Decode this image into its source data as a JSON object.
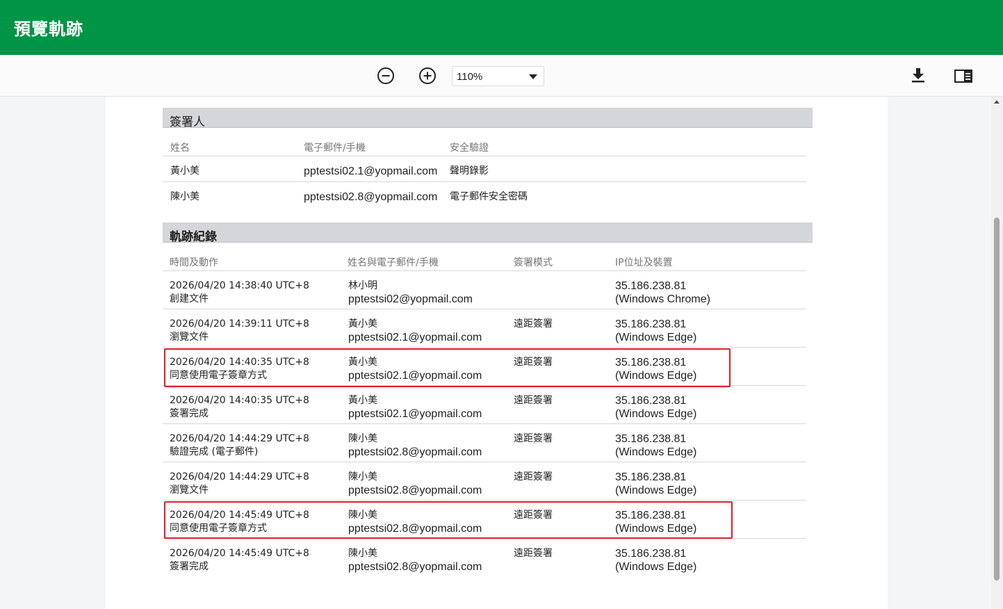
{
  "header": {
    "title": "預覽軌跡"
  },
  "toolbar": {
    "zoom_value": "110%",
    "icons": [
      "zoom-out-icon",
      "zoom-in-icon",
      "download-icon",
      "sidebar-toggle-icon"
    ]
  },
  "signers": {
    "title": "簽署人",
    "columns": [
      "姓名",
      "電子郵件/手機",
      "安全驗證"
    ],
    "rows": [
      {
        "name": "黃小美",
        "email": "pptestsi02.1@yopmail.com",
        "verify": "聲明錄影"
      },
      {
        "name": "陳小美",
        "email": "pptestsi02.8@yopmail.com",
        "verify": "電子郵件安全密碼"
      }
    ]
  },
  "log": {
    "title": "軌跡紀錄",
    "columns": [
      "時間及動作",
      "姓名與電子郵件/手機",
      "簽署模式",
      "IP位址及裝置"
    ],
    "rows": [
      {
        "time": "2026/04/20 14:38:40 UTC+8",
        "action": "創建文件",
        "name": "林小明",
        "email": "pptestsi02@yopmail.com",
        "mode": "",
        "ip": "35.186.238.81",
        "device": "(Windows Chrome)"
      },
      {
        "time": "2026/04/20 14:39:11 UTC+8",
        "action": "瀏覽文件",
        "name": "黃小美",
        "email": "pptestsi02.1@yopmail.com",
        "mode": "遠距簽署",
        "ip": "35.186.238.81",
        "device": "(Windows Edge)"
      },
      {
        "time": "2026/04/20 14:40:35 UTC+8",
        "action": "同意使用電子簽章方式",
        "name": "黃小美",
        "email": "pptestsi02.1@yopmail.com",
        "mode": "遠距簽署",
        "ip": "35.186.238.81",
        "device": "(Windows Edge)"
      },
      {
        "time": "2026/04/20 14:40:35 UTC+8",
        "action": "簽署完成",
        "name": "黃小美",
        "email": "pptestsi02.1@yopmail.com",
        "mode": "遠距簽署",
        "ip": "35.186.238.81",
        "device": "(Windows Edge)"
      },
      {
        "time": "2026/04/20 14:44:29 UTC+8",
        "action": "驗證完成 (電子郵件)",
        "name": "陳小美",
        "email": "pptestsi02.8@yopmail.com",
        "mode": "遠距簽署",
        "ip": "35.186.238.81",
        "device": "(Windows Edge)"
      },
      {
        "time": "2026/04/20 14:44:29 UTC+8",
        "action": "瀏覽文件",
        "name": "陳小美",
        "email": "pptestsi02.8@yopmail.com",
        "mode": "遠距簽署",
        "ip": "35.186.238.81",
        "device": "(Windows Edge)"
      },
      {
        "time": "2026/04/20 14:45:49 UTC+8",
        "action": "同意使用電子簽章方式",
        "name": "陳小美",
        "email": "pptestsi02.8@yopmail.com",
        "mode": "遠距簽署",
        "ip": "35.186.238.81",
        "device": "(Windows Edge)"
      },
      {
        "time": "2026/04/20 14:45:49 UTC+8",
        "action": "簽署完成",
        "name": "陳小美",
        "email": "pptestsi02.8@yopmail.com",
        "mode": "遠距簽署",
        "ip": "35.186.238.81",
        "device": "(Windows Edge)"
      }
    ]
  },
  "colors": {
    "header": "#009447",
    "highlight": "#e01c2c"
  }
}
